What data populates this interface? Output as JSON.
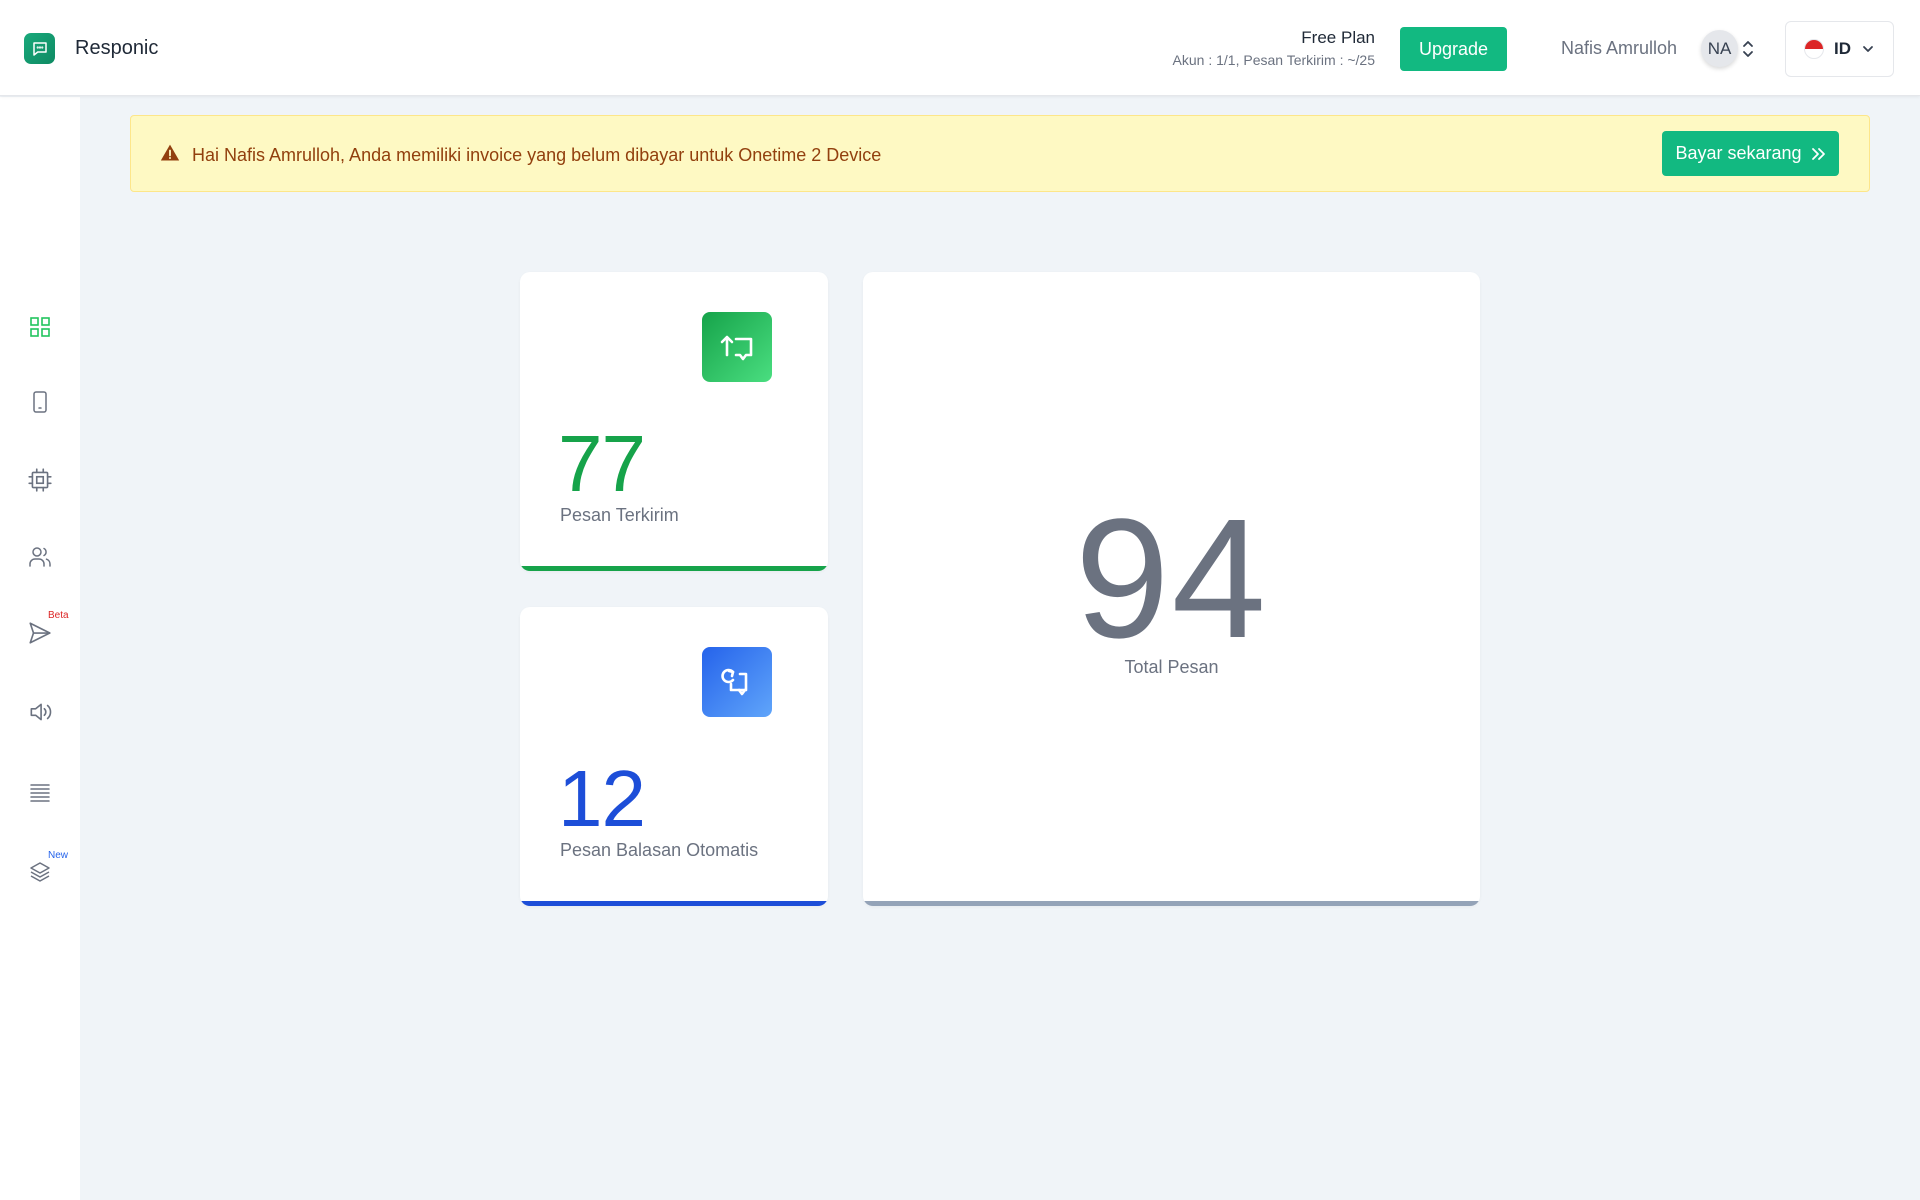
{
  "header": {
    "app_name": "Responic",
    "plan_name": "Free Plan",
    "plan_meta": "Akun : 1/1,  Pesan Terkirim : ~/25",
    "upgrade_label": "Upgrade",
    "user_name": "Nafis Amrulloh",
    "avatar_initials": "NA",
    "language": "ID"
  },
  "sidebar": {
    "items": [
      {
        "name": "dashboard",
        "icon": "grid-icon",
        "active": true
      },
      {
        "name": "device",
        "icon": "smartphone-icon"
      },
      {
        "name": "integration",
        "icon": "cpu-icon"
      },
      {
        "name": "contacts",
        "icon": "users-icon"
      },
      {
        "name": "send",
        "icon": "send-icon",
        "badge": "Beta"
      },
      {
        "name": "broadcast",
        "icon": "speaker-icon"
      },
      {
        "name": "logs",
        "icon": "list-icon"
      },
      {
        "name": "layers",
        "icon": "layers-icon",
        "badge": "New"
      }
    ]
  },
  "alert": {
    "message": "Hai Nafis Amrulloh, Anda memiliki invoice yang belum dibayar untuk Onetime 2 Device",
    "button_label": "Bayar sekarang"
  },
  "stats": {
    "sent": {
      "value": "77",
      "label": "Pesan Terkirim",
      "color": "#16a34a"
    },
    "auto_reply": {
      "value": "12",
      "label": "Pesan Balasan Otomatis",
      "color": "#1d4ed8"
    },
    "total": {
      "value": "94",
      "label": "Total Pesan",
      "color": "#6b7280"
    }
  },
  "colors": {
    "brand": "#12b981",
    "alert_bg": "#fef9c3",
    "alert_text": "#92400e",
    "badge_beta": "#dc2626",
    "badge_new": "#2563eb"
  }
}
